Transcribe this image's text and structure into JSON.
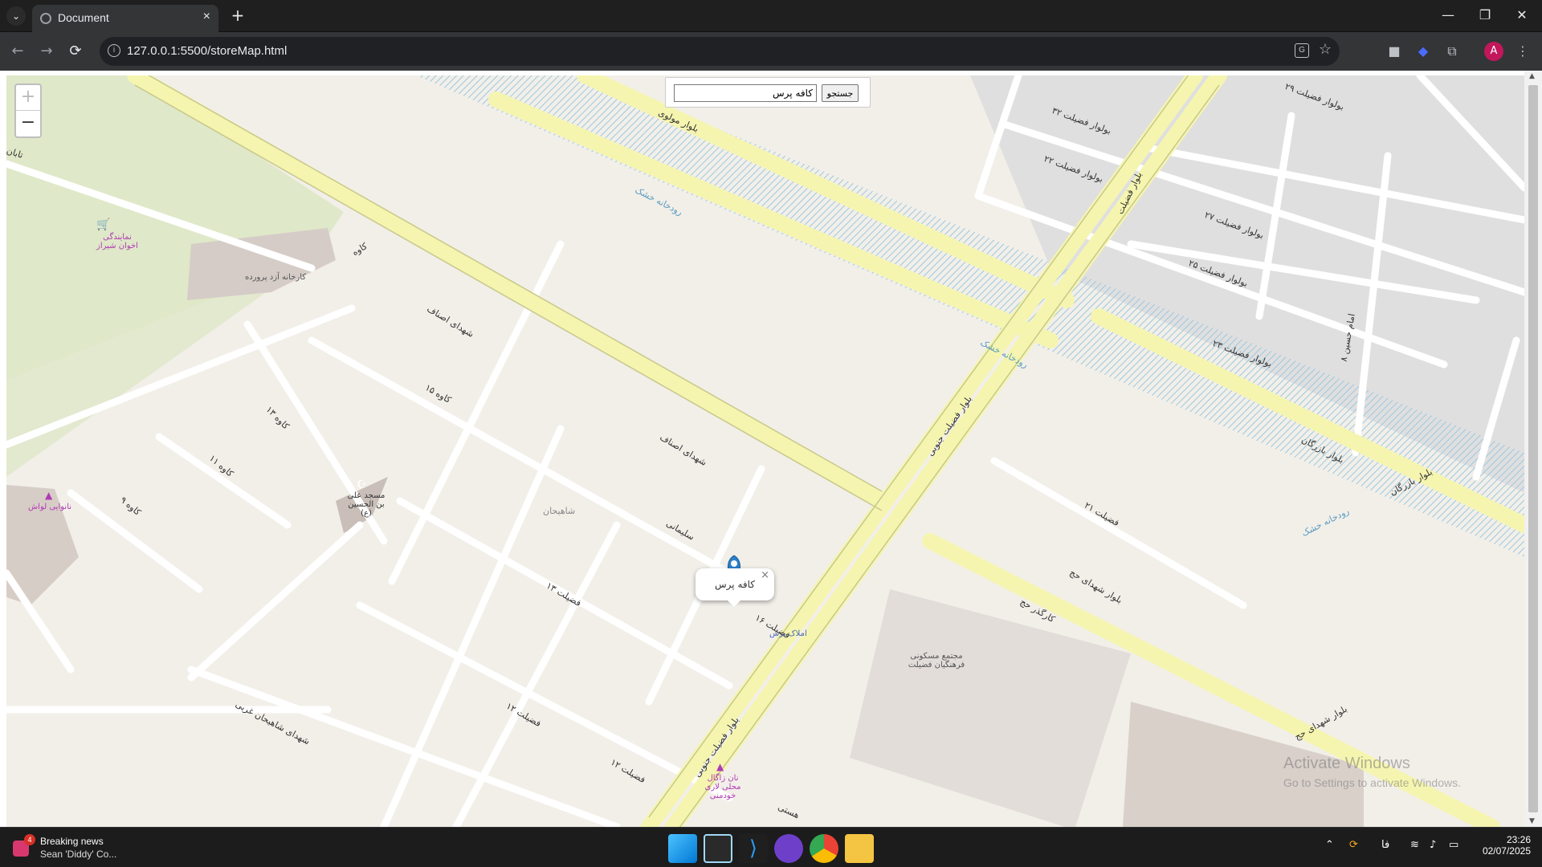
{
  "browser": {
    "tab_title": "Document",
    "tab_close": "×",
    "new_tab": "+",
    "url": "127.0.0.1:5500/storeMap.html",
    "back": "←",
    "forward": "→",
    "reload": "⟳",
    "info": "i",
    "star": "☆",
    "avatar_letter": "A",
    "minimize": "—",
    "restore": "❐",
    "close": "✕"
  },
  "map": {
    "zoom_in": "+",
    "zoom_out": "−",
    "search": {
      "value": "کافه پرس",
      "button": "جستجو"
    },
    "popup": {
      "text": "کافه پرس",
      "close": "×"
    },
    "labels": {
      "shohada_esfaf": "شهدای اصناف",
      "tabnak": "تابان",
      "kaveh": "کاوه",
      "davar_movalavi": "بلوار مولوی",
      "fazilat_jonoobi": "بلوار فضیلت جنوبی",
      "fazilat_blvd": "بلوار فضیلت",
      "shohada_haj": "بلوار شهدای حج",
      "bazargan": "بلوار بازرگان",
      "river": "رودخانه خشک",
      "fazilat21": "فضیلت ۲۱",
      "fazilat12": "فضیلت ۱۲",
      "fazilat13": "فضیلت ۱۳",
      "fazilat16": "فضیلت ۱۶",
      "fazilat22": "بولوار فضیلت ۲۲",
      "fazilat23": "بولوار فضیلت ۲۳",
      "fazilat25": "بولوار فضیلت ۲۵",
      "fazilat27": "بولوار فضیلت ۲۷",
      "fazilat29": "بولوار فضیلت ۲۹",
      "fazilat32": "بولوار فضیلت ۳۲",
      "soleimani": "سلیمانی",
      "shahihan": "شاهیحان",
      "shahihan_gharbi": "شهدای شاهیحان غربی",
      "kaveh15": "کاوه ۱۵",
      "kaveh13": "کاوه ۱۳",
      "kaveh11": "کاوه ۱۱",
      "kaveh9": "کاوه ۹",
      "hosseini": "هستی",
      "factory": "کارخانه آزد پرورده",
      "mosque": "مسجد علی بن الحسین (ع)",
      "representative": "نمایندگی اخوان شیراز",
      "bakery1": "نانوایی لواش",
      "bakery2": "نان زاگال محلی لاری خودمنی",
      "complex": "مجتمع مسکونی فرهنگیان فضیلت",
      "amlak": "املاک پرس",
      "imam": "امام حسین ۸",
      "kargar_haj": "کارگذر حج"
    }
  },
  "watermark": {
    "line1": "Activate Windows",
    "line2": "Go to Settings to activate Windows."
  },
  "taskbar": {
    "news_title": "Breaking news",
    "news_sub": "Sean 'Diddy' Co...",
    "news_badge": "4",
    "lang": "فا",
    "time": "23:26",
    "date": "02/07/2025"
  }
}
